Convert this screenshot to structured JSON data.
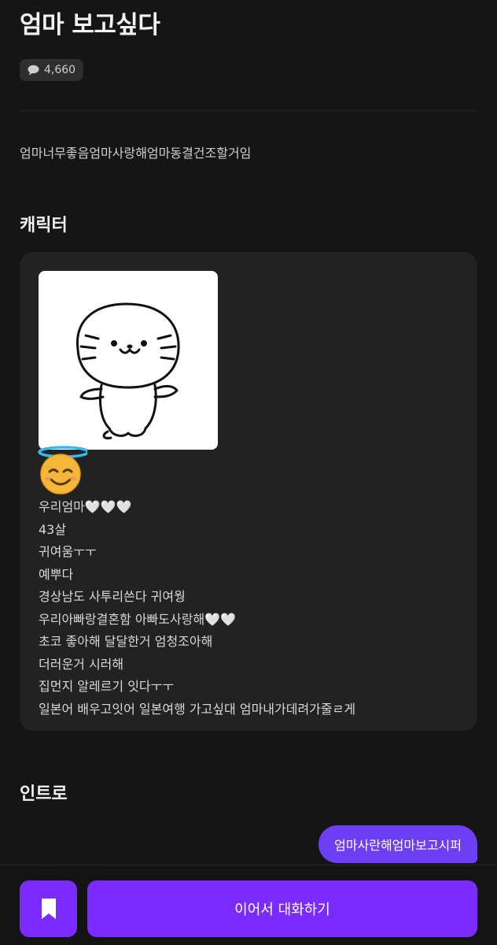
{
  "header": {
    "title": "엄마 보고싶다",
    "comment_count": "4,660"
  },
  "description": "엄마너무좋음엄마사랑해엄마동결건조할거임",
  "character_section": {
    "heading": "캐릭터",
    "image_name": "seal-character-drawing",
    "emoji_name": "smiling-face-with-halo",
    "bio_lines": [
      "우리엄마🤍🤍🤍",
      "43살",
      "귀여움ㅜㅜ",
      "예뿌다",
      "경상남도 사투리쓴다 귀여웡",
      "우리아빠랑결혼함 아빠도사랑해🤍🤍",
      "초코 좋아해 달달한거 엄청조아해",
      "더러운거 시러해",
      "집먼지 알레르기 잇다ㅜㅜ",
      "일본어 배우고잇어 일본여행 가고싶대 엄마내가데려가줄ㄹ게"
    ]
  },
  "intro_section": {
    "heading": "인트로",
    "message": "엄마사란해엄마보고시퍼"
  },
  "actions": {
    "bookmark_icon": "bookmark-icon",
    "continue_label": "이어서 대화하기"
  },
  "colors": {
    "background": "#151515",
    "card": "#222222",
    "accent": "#7a2bff",
    "bubble": "#6c3ff5"
  }
}
